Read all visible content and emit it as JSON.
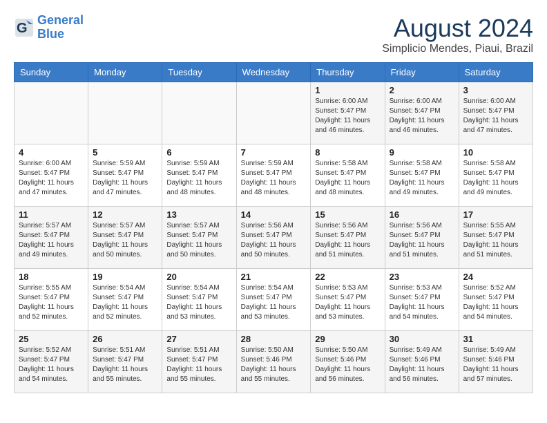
{
  "header": {
    "logo_line1": "General",
    "logo_line2": "Blue",
    "month": "August 2024",
    "location": "Simplicio Mendes, Piaui, Brazil"
  },
  "weekdays": [
    "Sunday",
    "Monday",
    "Tuesday",
    "Wednesday",
    "Thursday",
    "Friday",
    "Saturday"
  ],
  "weeks": [
    [
      {
        "day": "",
        "info": ""
      },
      {
        "day": "",
        "info": ""
      },
      {
        "day": "",
        "info": ""
      },
      {
        "day": "",
        "info": ""
      },
      {
        "day": "1",
        "info": "Sunrise: 6:00 AM\nSunset: 5:47 PM\nDaylight: 11 hours and 46 minutes."
      },
      {
        "day": "2",
        "info": "Sunrise: 6:00 AM\nSunset: 5:47 PM\nDaylight: 11 hours and 46 minutes."
      },
      {
        "day": "3",
        "info": "Sunrise: 6:00 AM\nSunset: 5:47 PM\nDaylight: 11 hours and 47 minutes."
      }
    ],
    [
      {
        "day": "4",
        "info": "Sunrise: 6:00 AM\nSunset: 5:47 PM\nDaylight: 11 hours and 47 minutes."
      },
      {
        "day": "5",
        "info": "Sunrise: 5:59 AM\nSunset: 5:47 PM\nDaylight: 11 hours and 47 minutes."
      },
      {
        "day": "6",
        "info": "Sunrise: 5:59 AM\nSunset: 5:47 PM\nDaylight: 11 hours and 48 minutes."
      },
      {
        "day": "7",
        "info": "Sunrise: 5:59 AM\nSunset: 5:47 PM\nDaylight: 11 hours and 48 minutes."
      },
      {
        "day": "8",
        "info": "Sunrise: 5:58 AM\nSunset: 5:47 PM\nDaylight: 11 hours and 48 minutes."
      },
      {
        "day": "9",
        "info": "Sunrise: 5:58 AM\nSunset: 5:47 PM\nDaylight: 11 hours and 49 minutes."
      },
      {
        "day": "10",
        "info": "Sunrise: 5:58 AM\nSunset: 5:47 PM\nDaylight: 11 hours and 49 minutes."
      }
    ],
    [
      {
        "day": "11",
        "info": "Sunrise: 5:57 AM\nSunset: 5:47 PM\nDaylight: 11 hours and 49 minutes."
      },
      {
        "day": "12",
        "info": "Sunrise: 5:57 AM\nSunset: 5:47 PM\nDaylight: 11 hours and 50 minutes."
      },
      {
        "day": "13",
        "info": "Sunrise: 5:57 AM\nSunset: 5:47 PM\nDaylight: 11 hours and 50 minutes."
      },
      {
        "day": "14",
        "info": "Sunrise: 5:56 AM\nSunset: 5:47 PM\nDaylight: 11 hours and 50 minutes."
      },
      {
        "day": "15",
        "info": "Sunrise: 5:56 AM\nSunset: 5:47 PM\nDaylight: 11 hours and 51 minutes."
      },
      {
        "day": "16",
        "info": "Sunrise: 5:56 AM\nSunset: 5:47 PM\nDaylight: 11 hours and 51 minutes."
      },
      {
        "day": "17",
        "info": "Sunrise: 5:55 AM\nSunset: 5:47 PM\nDaylight: 11 hours and 51 minutes."
      }
    ],
    [
      {
        "day": "18",
        "info": "Sunrise: 5:55 AM\nSunset: 5:47 PM\nDaylight: 11 hours and 52 minutes."
      },
      {
        "day": "19",
        "info": "Sunrise: 5:54 AM\nSunset: 5:47 PM\nDaylight: 11 hours and 52 minutes."
      },
      {
        "day": "20",
        "info": "Sunrise: 5:54 AM\nSunset: 5:47 PM\nDaylight: 11 hours and 53 minutes."
      },
      {
        "day": "21",
        "info": "Sunrise: 5:54 AM\nSunset: 5:47 PM\nDaylight: 11 hours and 53 minutes."
      },
      {
        "day": "22",
        "info": "Sunrise: 5:53 AM\nSunset: 5:47 PM\nDaylight: 11 hours and 53 minutes."
      },
      {
        "day": "23",
        "info": "Sunrise: 5:53 AM\nSunset: 5:47 PM\nDaylight: 11 hours and 54 minutes."
      },
      {
        "day": "24",
        "info": "Sunrise: 5:52 AM\nSunset: 5:47 PM\nDaylight: 11 hours and 54 minutes."
      }
    ],
    [
      {
        "day": "25",
        "info": "Sunrise: 5:52 AM\nSunset: 5:47 PM\nDaylight: 11 hours and 54 minutes."
      },
      {
        "day": "26",
        "info": "Sunrise: 5:51 AM\nSunset: 5:47 PM\nDaylight: 11 hours and 55 minutes."
      },
      {
        "day": "27",
        "info": "Sunrise: 5:51 AM\nSunset: 5:47 PM\nDaylight: 11 hours and 55 minutes."
      },
      {
        "day": "28",
        "info": "Sunrise: 5:50 AM\nSunset: 5:46 PM\nDaylight: 11 hours and 55 minutes."
      },
      {
        "day": "29",
        "info": "Sunrise: 5:50 AM\nSunset: 5:46 PM\nDaylight: 11 hours and 56 minutes."
      },
      {
        "day": "30",
        "info": "Sunrise: 5:49 AM\nSunset: 5:46 PM\nDaylight: 11 hours and 56 minutes."
      },
      {
        "day": "31",
        "info": "Sunrise: 5:49 AM\nSunset: 5:46 PM\nDaylight: 11 hours and 57 minutes."
      }
    ]
  ]
}
